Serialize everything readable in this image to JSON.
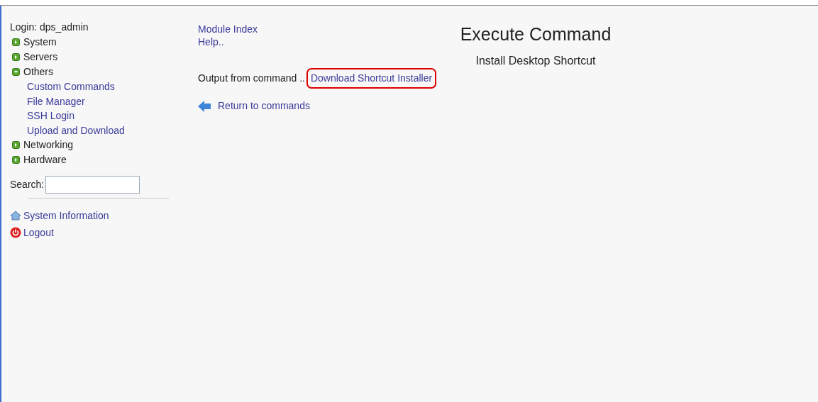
{
  "sidebar": {
    "login": "Login: dps_admin",
    "tree": [
      {
        "label": "System",
        "expanded": false
      },
      {
        "label": "Servers",
        "expanded": false
      },
      {
        "label": "Others",
        "expanded": true,
        "children": [
          {
            "label": "Custom Commands"
          },
          {
            "label": "File Manager"
          },
          {
            "label": "SSH Login"
          },
          {
            "label": "Upload and Download"
          }
        ]
      },
      {
        "label": "Networking",
        "expanded": false
      },
      {
        "label": "Hardware",
        "expanded": false
      }
    ],
    "search": {
      "label": "Search:"
    },
    "links": [
      {
        "kind": "home",
        "label": "System Information"
      },
      {
        "kind": "power",
        "label": "Logout"
      }
    ]
  },
  "main": {
    "links": [
      "Module Index",
      "Help.."
    ],
    "title": "Execute Command",
    "subtitle": "Install Desktop Shortcut",
    "output_label": "Output from command ..",
    "output_link": {
      "label": "Download Shortcut Installer",
      "highlighted": true
    },
    "return_link": "Return to commands"
  }
}
